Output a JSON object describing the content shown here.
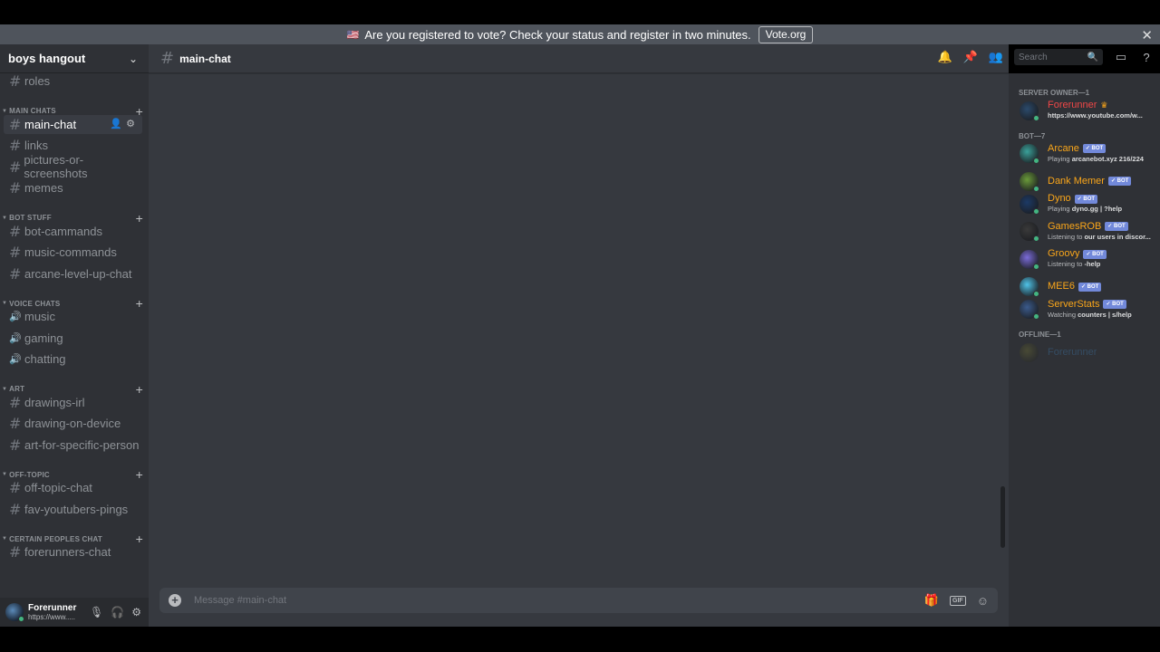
{
  "colors": {
    "bg_main": "#36393f",
    "bg_sidebar": "#2f3136",
    "accent": "#7289da",
    "online": "#43b581",
    "owner": "#f04747",
    "bot": "#faa61a"
  },
  "notice": {
    "flag_icon": "us-flag-icon",
    "text": "Are you registered to vote? Check your status and register in two minutes.",
    "button": "Vote.org",
    "close": "✕"
  },
  "server": {
    "name": "boys hangout"
  },
  "sidebar": {
    "items": [
      {
        "kind": "channel",
        "label": "roles"
      },
      {
        "kind": "category",
        "label": "MAIN CHATS"
      },
      {
        "kind": "channel",
        "label": "main-chat",
        "active": true
      },
      {
        "kind": "channel",
        "label": "links"
      },
      {
        "kind": "channel",
        "label": "pictures-or-screenshots"
      },
      {
        "kind": "channel",
        "label": "memes"
      },
      {
        "kind": "category",
        "label": "BOT STUFF"
      },
      {
        "kind": "channel",
        "label": "bot-cammands"
      },
      {
        "kind": "channel",
        "label": "music-commands"
      },
      {
        "kind": "channel",
        "label": "arcane-level-up-chat"
      },
      {
        "kind": "category",
        "label": "VOICE CHATS"
      },
      {
        "kind": "voice",
        "label": "music"
      },
      {
        "kind": "voice",
        "label": "gaming"
      },
      {
        "kind": "voice",
        "label": "chatting"
      },
      {
        "kind": "category",
        "label": "ART"
      },
      {
        "kind": "channel",
        "label": "drawings-irl"
      },
      {
        "kind": "channel",
        "label": "drawing-on-device"
      },
      {
        "kind": "channel",
        "label": "art-for-specific-person"
      },
      {
        "kind": "category",
        "label": "OFF-TOPIC"
      },
      {
        "kind": "channel",
        "label": "off-topic-chat"
      },
      {
        "kind": "channel",
        "label": "fav-youtubers-pings"
      },
      {
        "kind": "category",
        "label": "CERTAIN PEOPLES CHAT"
      },
      {
        "kind": "channel",
        "label": "forerunners-chat"
      }
    ]
  },
  "user": {
    "name": "Forerunner",
    "status": "https://www....."
  },
  "header": {
    "channel": "main-chat",
    "search_placeholder": "Search"
  },
  "composer": {
    "placeholder": "Message #main-chat",
    "gif": "GIF"
  },
  "members": {
    "groups": [
      {
        "label": "SERVER OWNER—1",
        "members": [
          {
            "name": "Forerunner",
            "color": "#f04747",
            "owner": true,
            "activity_prefix": "",
            "activity": "https://www.youtube.com/w...",
            "avatar": "#2b4a6b"
          }
        ]
      },
      {
        "label": "BOT—7",
        "members": [
          {
            "name": "Arcane",
            "color": "#faa61a",
            "bot": true,
            "activity_prefix": "Playing",
            "activity": "arcanebot.xyz 216/224",
            "avatar": "#3aa19a"
          },
          {
            "name": "Dank Memer",
            "color": "#faa61a",
            "bot": true,
            "activity_prefix": "",
            "activity": "",
            "avatar": "#6a9a3a"
          },
          {
            "name": "Dyno",
            "color": "#faa61a",
            "bot": true,
            "activity_prefix": "Playing",
            "activity": "dyno.gg | ?help",
            "avatar": "#1c3a66"
          },
          {
            "name": "GamesROB",
            "color": "#faa61a",
            "bot": true,
            "activity_prefix": "Listening to",
            "activity": "our users in discor...",
            "avatar": "#3a3a3a"
          },
          {
            "name": "Groovy",
            "color": "#faa61a",
            "bot": true,
            "activity_prefix": "Listening to",
            "activity": "-help",
            "avatar": "#7b6cd9"
          },
          {
            "name": "MEE6",
            "color": "#faa61a",
            "bot": true,
            "activity_prefix": "",
            "activity": "",
            "avatar": "#4fc3e8"
          },
          {
            "name": "ServerStats",
            "color": "#faa61a",
            "bot": true,
            "activity_prefix": "Watching",
            "activity": "counters | s/help",
            "avatar": "#3b5b8c"
          }
        ]
      },
      {
        "label": "OFFLINE—1",
        "members": [
          {
            "name": "Forerunner",
            "color": "#3e7fb8",
            "offline": true,
            "activity_prefix": "",
            "activity": "",
            "avatar": "#777733"
          }
        ]
      }
    ]
  },
  "bot_tag": "✓ BOT"
}
